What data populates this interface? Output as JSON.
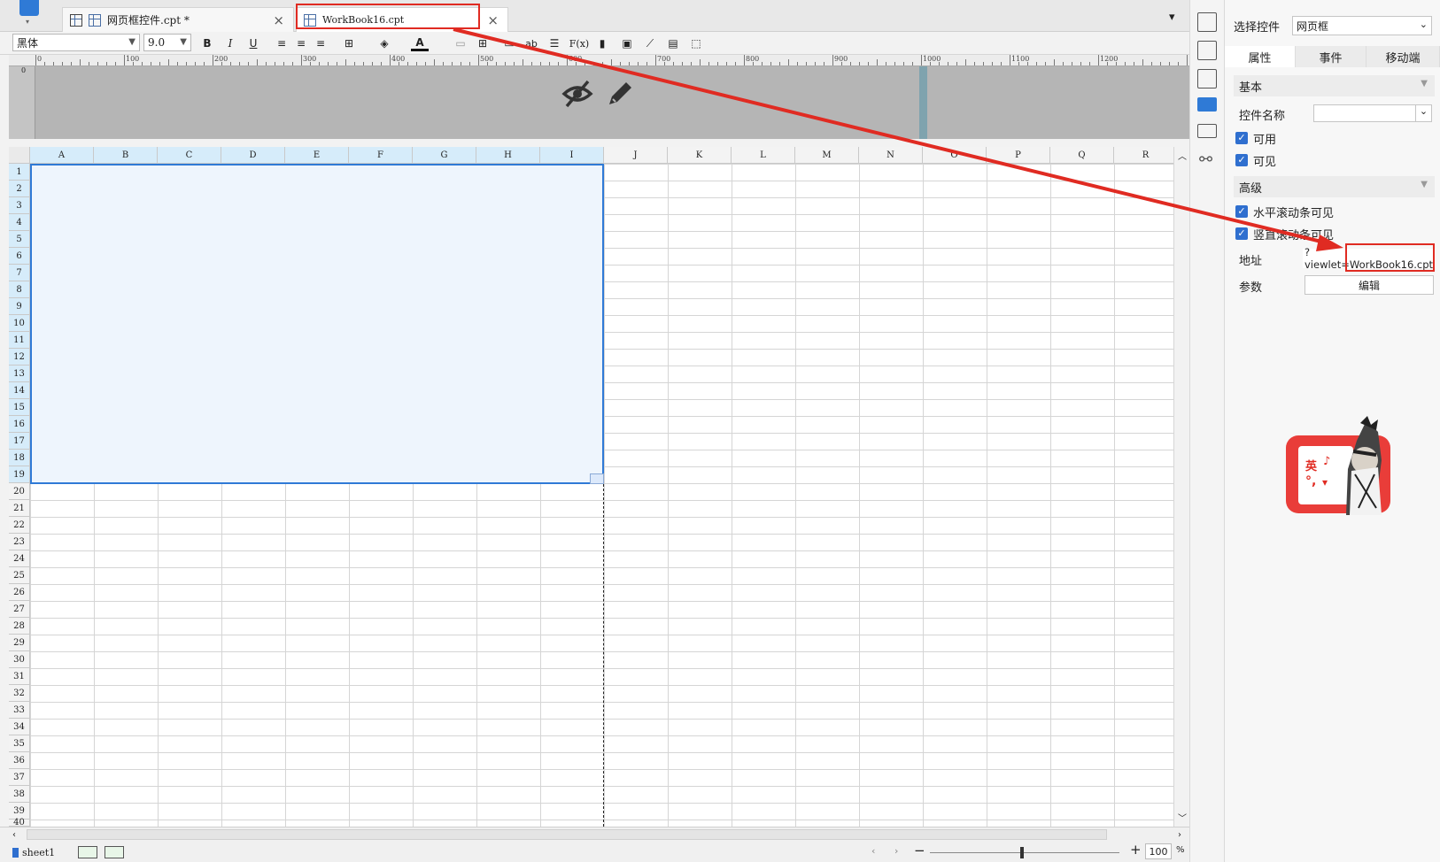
{
  "tabs": [
    {
      "label": "网页框控件.cpt *",
      "active": false
    },
    {
      "label": "WorkBook16.cpt",
      "active": true
    }
  ],
  "toolbar": {
    "font": "黑体",
    "size": "9.0",
    "bold": "B",
    "italic": "I",
    "underline": "U",
    "text_color": "A",
    "wrap": "ab",
    "formula": "F(x)"
  },
  "ruler_labels": [
    "0",
    "100",
    "200",
    "300",
    "400",
    "500",
    "600",
    "700",
    "800",
    "900",
    "1000",
    "1100",
    "1200"
  ],
  "vruler_label": "0",
  "columns": [
    "A",
    "B",
    "C",
    "D",
    "E",
    "F",
    "G",
    "H",
    "I",
    "J",
    "K",
    "L",
    "M",
    "N",
    "O",
    "P",
    "Q",
    "R"
  ],
  "rows": [
    "1",
    "2",
    "3",
    "4",
    "5",
    "6",
    "7",
    "8",
    "9",
    "10",
    "11",
    "12",
    "13",
    "14",
    "15",
    "16",
    "17",
    "18",
    "19",
    "20",
    "21",
    "22",
    "23",
    "24",
    "25",
    "26",
    "27",
    "28",
    "29",
    "30",
    "31",
    "32",
    "33",
    "34",
    "35",
    "36",
    "37",
    "38",
    "39",
    "40"
  ],
  "bottom": {
    "sheet": "sheet1",
    "zoom": "100",
    "zoom_unit": "%",
    "minus": "−",
    "plus": "+"
  },
  "panel": {
    "select_label": "选择控件",
    "select_value": "网页框",
    "tabs": [
      "属性",
      "事件",
      "移动端"
    ],
    "basic": "基本",
    "name_label": "控件名称",
    "enabled": "可用",
    "visible": "可见",
    "advanced": "高级",
    "hscroll": "水平滚动条可见",
    "vscroll": "竖直滚动条可见",
    "address_label": "地址",
    "address_value": "?viewlet=WorkBook16.cpt",
    "params_label": "参数",
    "edit_button": "编辑"
  },
  "sticker": {
    "char1": "英",
    "char2": "♪"
  },
  "colors": {
    "accent": "#2f6fcf",
    "selection_border": "#2f7ad6",
    "annotation": "#e02b22"
  }
}
